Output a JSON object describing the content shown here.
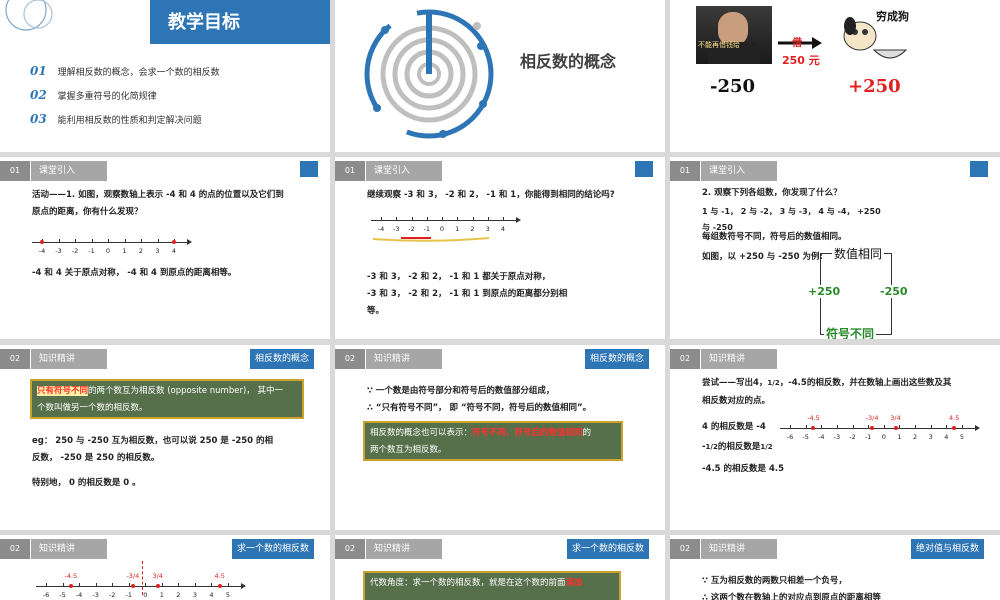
{
  "s1": {
    "title": "教学目标",
    "items": [
      {
        "num": "01",
        "text": "理解相反数的概念，会求一个数的相反数"
      },
      {
        "num": "02",
        "text": "掌握多重符号的化简规律"
      },
      {
        "num": "03",
        "text": "能利用相反数的性质和判定解决问题"
      }
    ]
  },
  "s2": {
    "title": "相反数的概念"
  },
  "s3": {
    "sign_text": "不能再借钱给",
    "arrow_text": "借",
    "money": "250 元",
    "dog_text": "穷成狗",
    "left_value": "-250",
    "right_value": "+250"
  },
  "s4": {
    "num": "01",
    "section": "课堂引入",
    "text1": "活动——1. 如图，观察数轴上表示 -4 和 4 的点的位置以及它们到",
    "text2": "原点的距离，你有什么发现？",
    "ticks": [
      "-4",
      "-3",
      "-2",
      "-1",
      "0",
      "1",
      "2",
      "3",
      "4"
    ],
    "conclusion": "-4 和 4 关于原点对称， -4 和 4 到原点的距离相等。"
  },
  "s5": {
    "num": "01",
    "section": "课堂引入",
    "text1": "继续观察 -3 和 3， -2 和 2， -1 和 1，你能得到相同的结论吗?",
    "ticks": [
      "-4",
      "-3",
      "-2",
      "-1",
      "0",
      "1",
      "2",
      "3",
      "4"
    ],
    "c1": "-3 和 3， -2 和 2， -1 和 1 都关于原点对称，",
    "c2": "-3 和 3， -2 和 2， -1 和 1 到原点的距离都分别相",
    "c3": "等。"
  },
  "s6": {
    "num": "01",
    "section": "课堂引入",
    "text1": "2. 观察下列各组数，你发现了什么？",
    "text2": "1 与 -1， 2 与 -2， 3 与 -3， 4 与 -4， +250",
    "text3": "与 -250",
    "red1": "每组数符号不同，符号后的数值相同。",
    "red2": "如图，以 +250 与 -250 为例:",
    "same_value": "数值相同",
    "left": "+250",
    "right": "-250",
    "diff_sign": "符号不同"
  },
  "s7": {
    "num": "02",
    "section": "知识精讲",
    "tag": "相反数的概念",
    "box_red": "只有符号不同",
    "box_rest1": "的两个数互为相反数 (opposite number)， 其中一",
    "box_rest2": "个数叫做另一个数的相反数。",
    "eg1": "eg： 250 与 -250 互为相反数，也可以说 250 是 -250 的相",
    "eg2": "反数， -250 是 250 的相反数。",
    "special": "特别地， 0 的相反数是 0 。"
  },
  "s8": {
    "num": "02",
    "section": "知识精讲",
    "tag": "相反数的概念",
    "t1": "∵ 一个数是由符号部分和符号后的数值部分组成，",
    "t2": "∴ “只有符号不同”， 即 “符号不同，符号后的数值相同”。",
    "box1": "相反数的概念也可以表示：",
    "box_red": "符号不同，符号后的数值相同",
    "box2": "的",
    "box3": "两个数互为相反数。"
  },
  "s9": {
    "num": "02",
    "section": "知识精讲",
    "t1": "尝试——写出4，",
    "t1frac": "1/2",
    "t1b": "，-4.5的相反数，并在数轴上画出这些数及其",
    "t2": "相反数对应的点。",
    "r1": "4 的相反数是 -4",
    "r2a": "-",
    "r2frac": "1/2",
    "r2b": "的相反数是",
    "r2frac2": "1/2",
    "r3": "-4.5 的相反数是 4.5",
    "ticks": [
      "-6",
      "-5",
      "-4",
      "-3",
      "-2",
      "-1",
      "0",
      "1",
      "2",
      "3",
      "4",
      "5"
    ],
    "marks": [
      "-4.5",
      "-3/4",
      "3/4",
      "4.5"
    ]
  },
  "s10": {
    "num": "02",
    "section": "知识精讲",
    "tag": "求一个数的相反数",
    "ticks": [
      "-6",
      "-5",
      "-4",
      "-3",
      "-2",
      "-1",
      "0",
      "1",
      "2",
      "3",
      "4",
      "5"
    ],
    "marks": [
      "-4.5",
      "-3/4",
      "3/4",
      "4.5"
    ]
  },
  "s11": {
    "num": "02",
    "section": "知识精讲",
    "tag": "求一个数的相反数",
    "box1": "代数角度：求一个数的相反数，就是在这个数的前面",
    "box_red": "添加"
  },
  "s12": {
    "num": "02",
    "section": "知识精讲",
    "tag": "绝对值与相反数",
    "t1": "∵ 互为相反数的两数只相差一个负号，",
    "t2": "∴ 这两个数在数轴上的对应点到原点的距离相等"
  }
}
